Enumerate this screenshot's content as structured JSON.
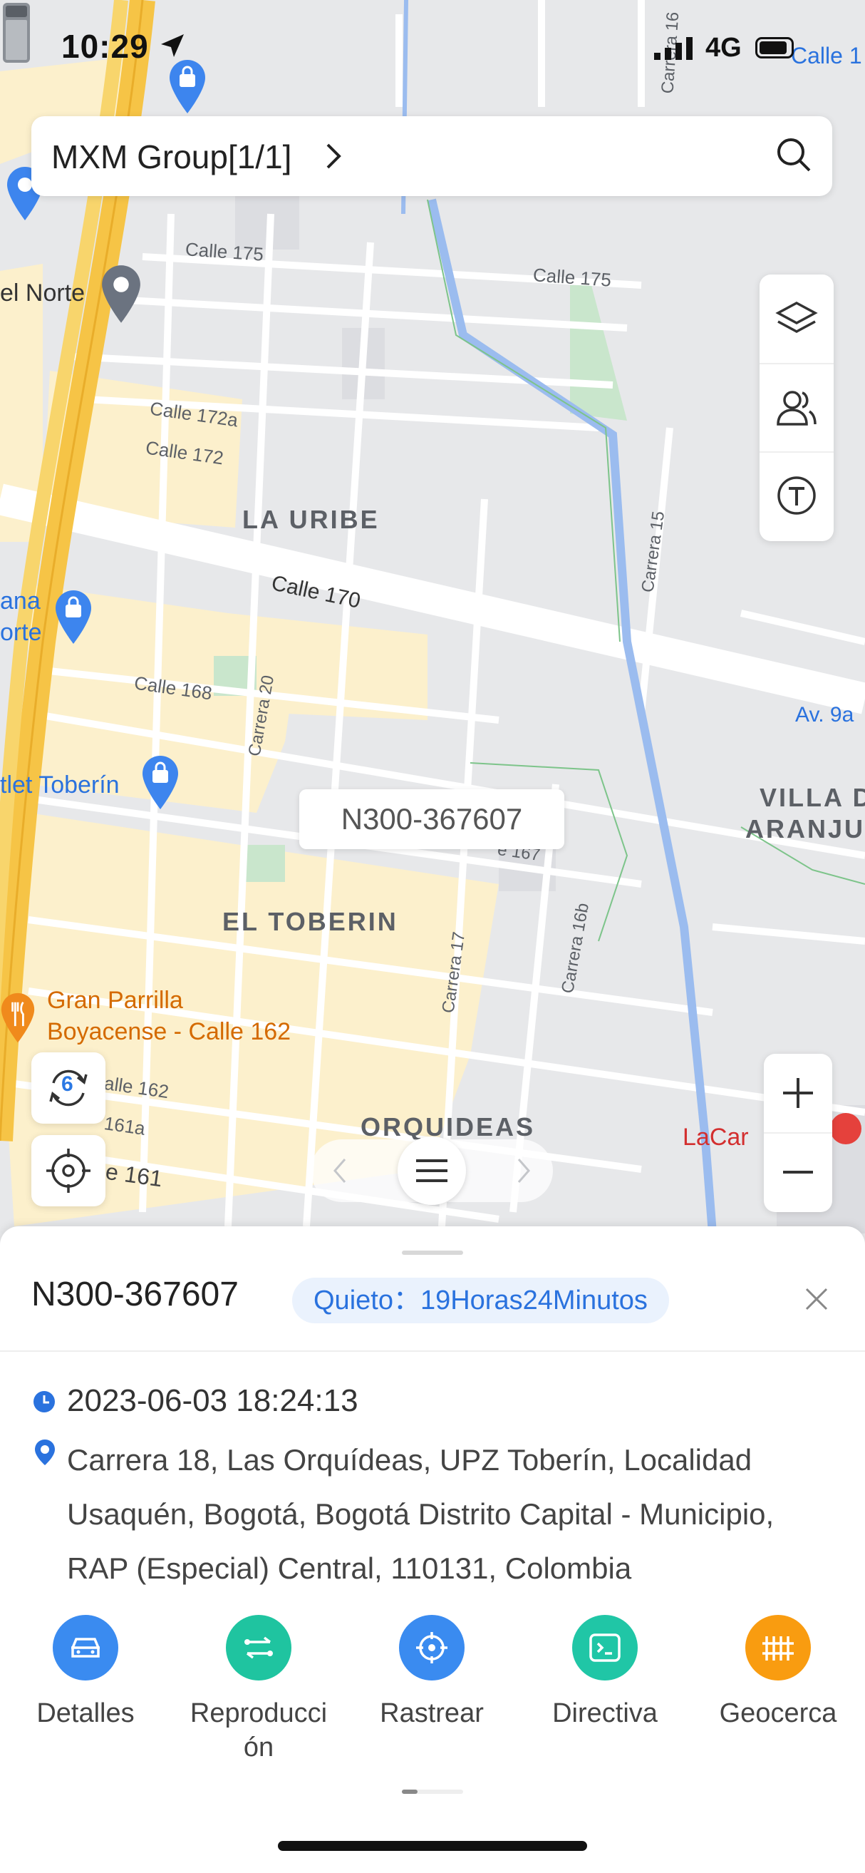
{
  "status_bar": {
    "time": "10:29",
    "network": "4G"
  },
  "header": {
    "group_label": "MXM Group[1/1]"
  },
  "map": {
    "labels": {
      "calle175a": "Calle 175",
      "calle175b": "Calle 175",
      "calle172a": "Calle 172a",
      "calle172": "Calle 172",
      "la_uribe": "LA URIBE",
      "calle170": "Calle 170",
      "calle168": "Calle 168",
      "carrera20": "Carrera 20",
      "carrera15": "Carrera 15",
      "av9a": "Av. 9a",
      "villa1": "VILLA D",
      "villa2": "ARANJU",
      "el_toberin": "EL TOBERIN",
      "carrera17": "Carrera 17",
      "carrera16b": "Carrera 16b",
      "calle167": "e 167",
      "calle162": "alle 162",
      "calle161a": "161a",
      "calle161": "e 161",
      "orquideas": "ORQUIDEAS",
      "del_norte": "el Norte",
      "ana": "ana",
      "orte": "orte",
      "outlet": "tlet Toberín",
      "parrilla1": "Gran Parrilla",
      "parrilla2": "Boyacense - Calle 162",
      "lacar": "LaCar",
      "calle16": "Carrera 16",
      "calle1": "Calle 1"
    },
    "vehicle_label": "N300-367607",
    "refresh_count": "6"
  },
  "panel": {
    "device": "N300-367607",
    "status_badge": "Quieto：19Horas24Minutos",
    "datetime": "2023-06-03 18:24:13",
    "address": "Carrera 18, Las Orquídeas, UPZ Toberín, Localidad Usaquén, Bogotá, Bogotá Distrito Capital - Municipio, RAP (Especial) Central, 110131, Colombia",
    "actions": [
      {
        "label": "Detalles",
        "icon": "car-icon",
        "color": "#3a8bf0"
      },
      {
        "label": "Reproducción",
        "icon": "route-icon",
        "color": "#1fc4a0"
      },
      {
        "label": "Rastrear",
        "icon": "crosshair-icon",
        "color": "#3a8bf0"
      },
      {
        "label": "Directiva",
        "icon": "terminal-icon",
        "color": "#20c6a6"
      },
      {
        "label": "Geocerca",
        "icon": "fence-icon",
        "color": "#f99c10"
      }
    ]
  },
  "colors": {
    "accent": "#2a72de",
    "highway": "#f5c542",
    "water": "#8ab4f8",
    "park": "#cde8d0",
    "urban": "#fdf1cc"
  }
}
